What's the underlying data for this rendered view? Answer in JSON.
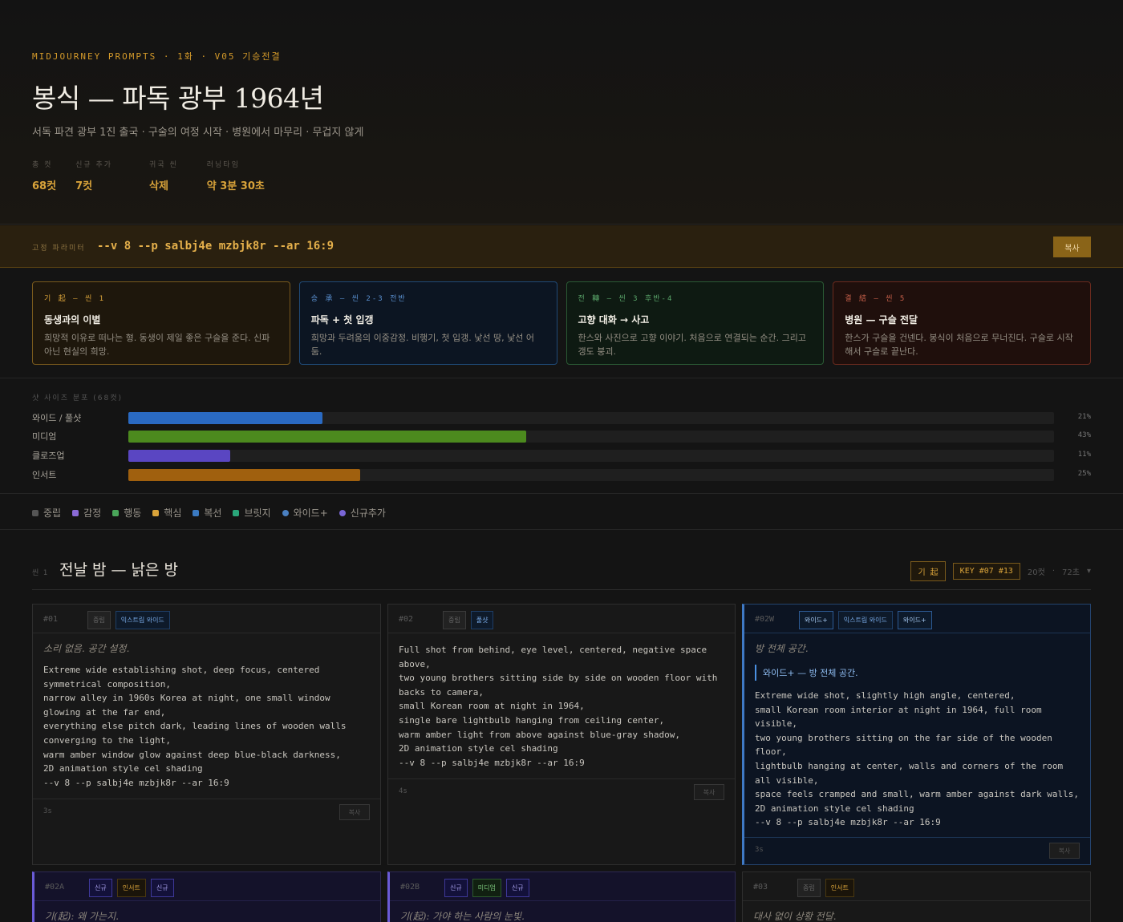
{
  "header": {
    "eyebrow": "MIDJOURNEY PROMPTS · 1화 · V05 기승전결",
    "title": "봉식 — 파독 광부 1964년",
    "subtitle": "서독 파견 광부 1진 출국 · 구술의 여정 시작 · 병원에서 마무리 · 무겁지 않게",
    "stats": [
      {
        "label": "총 컷",
        "value": "68컷"
      },
      {
        "label": "신규 추가",
        "value": "7컷"
      },
      {
        "label": "귀국 씬",
        "value": "삭제"
      },
      {
        "label": "러닝타임",
        "value": "약 3분 30초"
      }
    ]
  },
  "params": {
    "label": "고정 파라미터",
    "value": "--v 8 --p salbj4e mzbjk8r --ar 16:9",
    "copy_label": "복사"
  },
  "arcs": [
    {
      "head": "기 起 — 씬 1",
      "title": "동생과의 이별",
      "desc": "희망적 이유로 떠나는 형. 동생이 제일 좋은 구슬을 준다. 신파 아닌 현실의 희망."
    },
    {
      "head": "승 承 — 씬 2-3 전반",
      "title": "파독 + 첫 입갱",
      "desc": "희망과 두려움의 이중감정. 비행기, 첫 입갱. 낯선 땅, 낯선 어둠."
    },
    {
      "head": "전 轉 — 씬 3 후반-4",
      "title": "고향 대화 → 사고",
      "desc": "한스와 사진으로 고향 이야기. 처음으로 연결되는 순간. 그리고 갱도 붕괴."
    },
    {
      "head": "결 結 — 씬 5",
      "title": "병원 — 구슬 전달",
      "desc": "한스가 구슬을 건넨다. 봉식이 처음으로 무너진다. 구슬로 시작해서 구슬로 끝난다."
    }
  ],
  "distribution": {
    "label": "샷 사이즈 분포 (68컷)",
    "rows": [
      {
        "name": "와이드 / 풀샷",
        "pct_label": "21%",
        "fraction": 0.21,
        "color": "#2a6ac2"
      },
      {
        "name": "미디엄",
        "pct_label": "43%",
        "fraction": 0.43,
        "color": "#4c8a1e"
      },
      {
        "name": "클로즈업",
        "pct_label": "11%",
        "fraction": 0.11,
        "color": "#5a46c2"
      },
      {
        "name": "인서트",
        "pct_label": "25%",
        "fraction": 0.25,
        "color": "#a0600e"
      }
    ]
  },
  "legend": [
    {
      "label": "중립",
      "color": "#555555"
    },
    {
      "label": "감정",
      "color": "#8a6ad6"
    },
    {
      "label": "행동",
      "color": "#4aa65a"
    },
    {
      "label": "핵심",
      "color": "#d9a33a"
    },
    {
      "label": "복선",
      "color": "#3a7ac2"
    },
    {
      "label": "브릿지",
      "color": "#2aa67a"
    },
    {
      "label": "와이드+",
      "color": "#4a80c2"
    },
    {
      "label": "신규추가",
      "color": "#7a66d6"
    }
  ],
  "scene": {
    "num": "씬 1",
    "title": "전날 밤 — 낡은 방",
    "tag1": "기 起",
    "tag2": "KEY #07 #13",
    "count": "20컷",
    "seconds": "72초",
    "toggle": "▾"
  },
  "cards": [
    {
      "id": "#01",
      "chips": [
        {
          "label": "중립",
          "kind": "neutral"
        },
        {
          "label": "익스트림 와이드",
          "kind": "blue"
        }
      ],
      "intent": "소리 없음. 공간 설정.",
      "prompt": "Extreme wide establishing shot, deep focus, centered\nsymmetrical composition,\nnarrow alley in 1960s Korea at night, one small window\nglowing at the far end,\neverything else pitch dark, leading lines of wooden walls\nconverging to the light,\nwarm amber window glow against deep blue-black darkness,\n2D animation style cel shading\n--v 8 --p salbj4e mzbjk8r --ar 16:9",
      "duration": "3s",
      "copy": "복사"
    },
    {
      "id": "#02",
      "chips": [
        {
          "label": "중립",
          "kind": "neutral"
        },
        {
          "label": "풀샷",
          "kind": "blue"
        }
      ],
      "intent": "",
      "prompt": "Full shot from behind, eye level, centered, negative space\nabove,\ntwo young brothers sitting side by side on wooden floor with\nbacks to camera,\nsmall Korean room at night in 1964,\nsingle bare lightbulb hanging from ceiling center,\nwarm amber light from above against blue-gray shadow,\n2D animation style cel shading\n--v 8 --p salbj4e mzbjk8r --ar 16:9",
      "duration": "4s",
      "copy": "복사"
    },
    {
      "id": "#02W",
      "chips": [
        {
          "label": "와이드+",
          "kind": "wide"
        },
        {
          "label": "익스트림 와이드",
          "kind": "blue"
        },
        {
          "label": "와이드+",
          "kind": "wide"
        }
      ],
      "intent": "방 전체 공간.",
      "note": "와이드+ — 방 전체 공간.",
      "prompt": "Extreme wide shot, slightly high angle, centered,\nsmall Korean room interior at night in 1964, full room\nvisible,\ntwo young brothers sitting on the far side of the wooden\nfloor,\nlightbulb hanging at center, walls and corners of the room\nall visible,\nspace feels cramped and small, warm amber against dark walls,\n2D animation style cel shading\n--v 8 --p salbj4e mzbjk8r --ar 16:9",
      "duration": "3s",
      "copy": "복사"
    },
    {
      "id": "#02A",
      "chips": [
        {
          "label": "신규",
          "kind": "purple"
        },
        {
          "label": "인서트",
          "kind": "orange"
        },
        {
          "label": "신규",
          "kind": "purple"
        }
      ],
      "intent": "기(起): 왜 가는지."
    },
    {
      "id": "#02B",
      "chips": [
        {
          "label": "신규",
          "kind": "purple"
        },
        {
          "label": "미디엄",
          "kind": "green"
        },
        {
          "label": "신규",
          "kind": "purple"
        }
      ],
      "intent": "기(起): 가야 하는 사람의 눈빛."
    },
    {
      "id": "#03",
      "chips": [
        {
          "label": "중립",
          "kind": "neutral"
        },
        {
          "label": "인서트",
          "kind": "orange"
        }
      ],
      "intent": "대사 없이 상황 전달."
    }
  ]
}
